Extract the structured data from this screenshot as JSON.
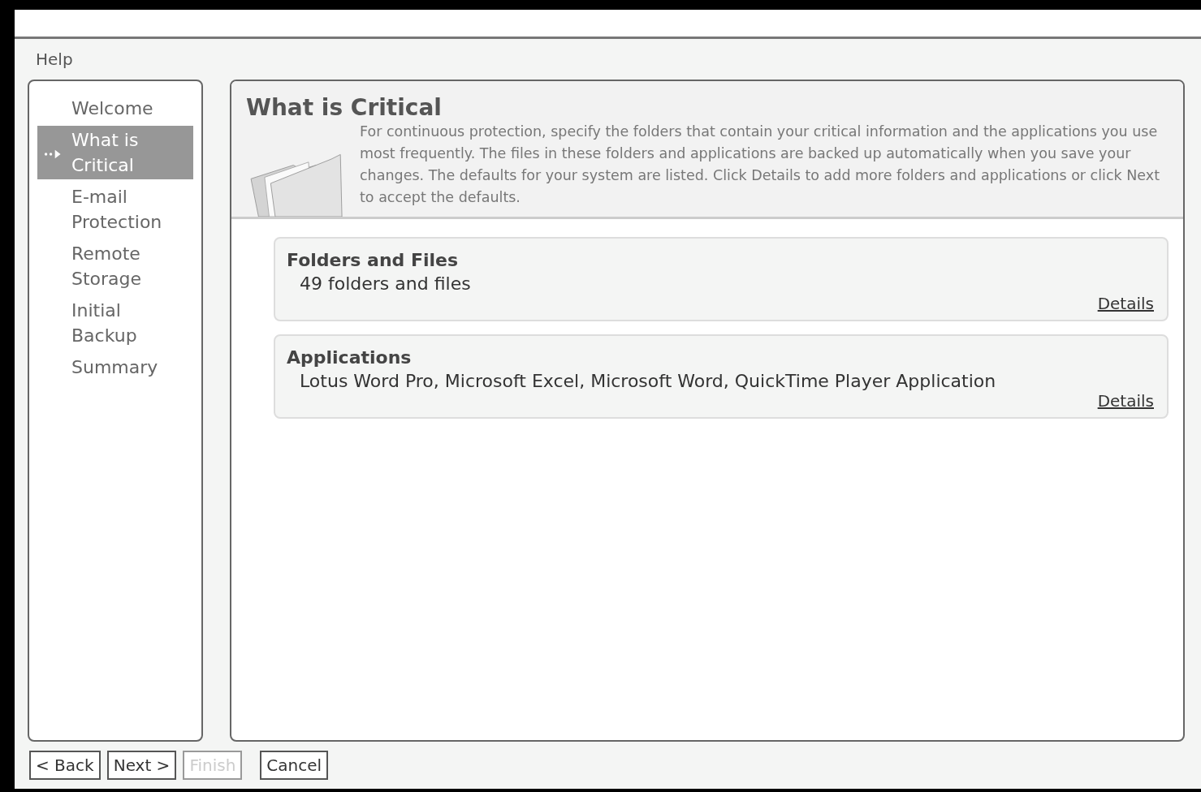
{
  "menu": [
    "Help"
  ],
  "steps": [
    {
      "label": "Welcome",
      "selected": false
    },
    {
      "label": "What is Critical",
      "selected": true
    },
    {
      "label": "E-mail Protection",
      "selected": false
    },
    {
      "label": "Remote Storage",
      "selected": false
    },
    {
      "label": "Initial Backup",
      "selected": false
    },
    {
      "label": "Summary",
      "selected": false
    }
  ],
  "header": {
    "title": "What is Critical",
    "description": "For continuous protection, specify the folders that contain your critical information and the applications you use most frequently. The files in these folders and applications are backed up automatically when you save your changes. The defaults for your system are listed. Click Details to add more folders and applications or click Next to accept the defaults."
  },
  "sections": [
    {
      "title": "Folders and Files",
      "summary": "49 folders and files",
      "link": "Details"
    },
    {
      "title": "Applications",
      "summary": "Lotus Word Pro, Microsoft Excel, Microsoft Word, QuickTime Player Application",
      "link": "Details"
    }
  ],
  "buttons": [
    {
      "label": "< Back",
      "disabled": false
    },
    {
      "label": "Next >",
      "disabled": false
    },
    {
      "label": "Finish",
      "disabled": true
    },
    {
      "label": "Cancel",
      "disabled": false
    }
  ]
}
